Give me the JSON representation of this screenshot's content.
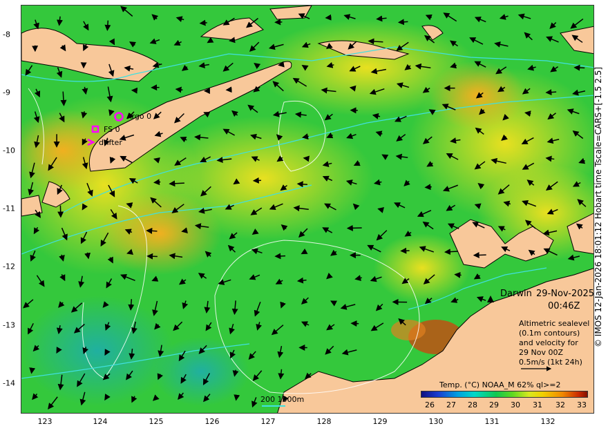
{
  "x_ticks": [
    "123",
    "124",
    "125",
    "126",
    "127",
    "128",
    "129",
    "130",
    "131",
    "132"
  ],
  "y_ticks": [
    "-8",
    "-9",
    "-10",
    "-11",
    "-12",
    "-13",
    "-14"
  ],
  "credit": "© IMOS 12-Jan-2026 18:01:12 Hobart time Tscale=CARS+[-1.5 2.5]",
  "platforms": [
    {
      "label": "Argo 0",
      "symbol": "circle"
    },
    {
      "label": "FS 0",
      "symbol": "square"
    },
    {
      "label": "drifter",
      "symbol": "chevron"
    }
  ],
  "place": "Darwin",
  "date": "29-Nov-2025",
  "time": "00:46Z",
  "info_lines": [
    "Altimetric sealevel",
    "(0.1m contours)",
    "and velocity for",
    "29 Nov 00Z",
    "0.5m/s (1kt 24h)"
  ],
  "scale_bar": "200 1000m",
  "legend_title": "Temp. (°C) NOAA_M 62% ql>=2",
  "colorbar_ticks": [
    "26",
    "27",
    "28",
    "29",
    "30",
    "31",
    "32",
    "33"
  ],
  "colors": {
    "land": "#f8c89a",
    "ocean_main": "#2ec840",
    "marker": "#ff00ff",
    "contour": "#40e0e0"
  }
}
